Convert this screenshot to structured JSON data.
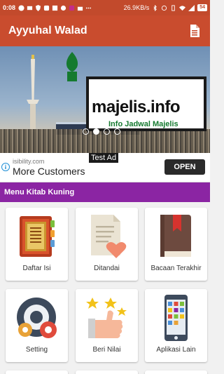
{
  "statusbar": {
    "time": "0:08",
    "speed": "26.9KB/s",
    "battery": "54"
  },
  "appbar": {
    "title": "Ayyuhal Walad",
    "action_icon": "document-icon"
  },
  "banner": {
    "brand": "majelis.info",
    "tagline": "Info Jadwal Majelis",
    "slide_count": 4,
    "active_slide": 2
  },
  "ad": {
    "badge": "Test Ad",
    "url": "isibility.com",
    "headline": "More Customers",
    "cta": "OPEN"
  },
  "section": {
    "title": "Menu Kitab Kuning"
  },
  "menu": [
    {
      "label": "Daftar Isi",
      "icon": "book-icon"
    },
    {
      "label": "Ditandai",
      "icon": "bookmark-heart-icon"
    },
    {
      "label": "Bacaan Terakhir",
      "icon": "book-ribbon-icon"
    },
    {
      "label": "Setting",
      "icon": "gears-icon"
    },
    {
      "label": "Beri Nilai",
      "icon": "thumbs-up-stars-icon"
    },
    {
      "label": "Aplikasi Lain",
      "icon": "phone-apps-icon"
    }
  ],
  "colors": {
    "primary": "#c94c2e",
    "section": "#8b25a3"
  }
}
